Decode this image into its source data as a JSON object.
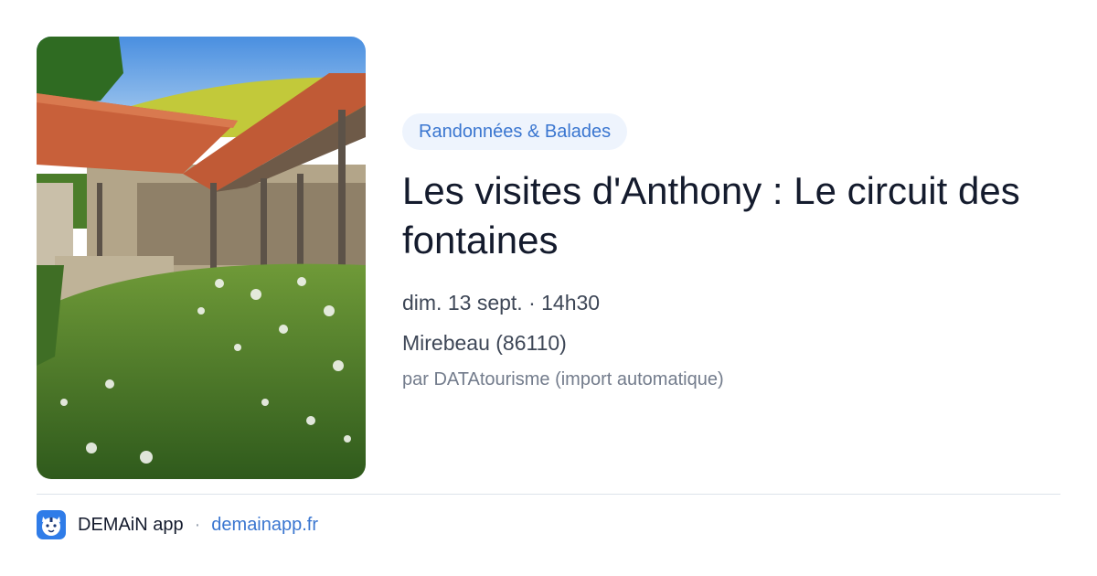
{
  "event": {
    "category": "Randonnées & Balades",
    "title": "Les visites d'Anthony : Le circuit des fontaines",
    "date_time": "dim. 13 sept. · 14h30",
    "location": "Mirebeau (86110)",
    "source": "par DATAtourisme (import automatique)"
  },
  "footer": {
    "app_name": "DEMAiN app",
    "separator": "·",
    "link": "demainapp.fr"
  },
  "icons": {
    "app_icon": "tiger-face-icon"
  },
  "colors": {
    "accent": "#3a76d0",
    "pill_background": "#eef4fd",
    "title": "#141b2d",
    "meta": "#3e4757",
    "muted": "#737c8c"
  }
}
